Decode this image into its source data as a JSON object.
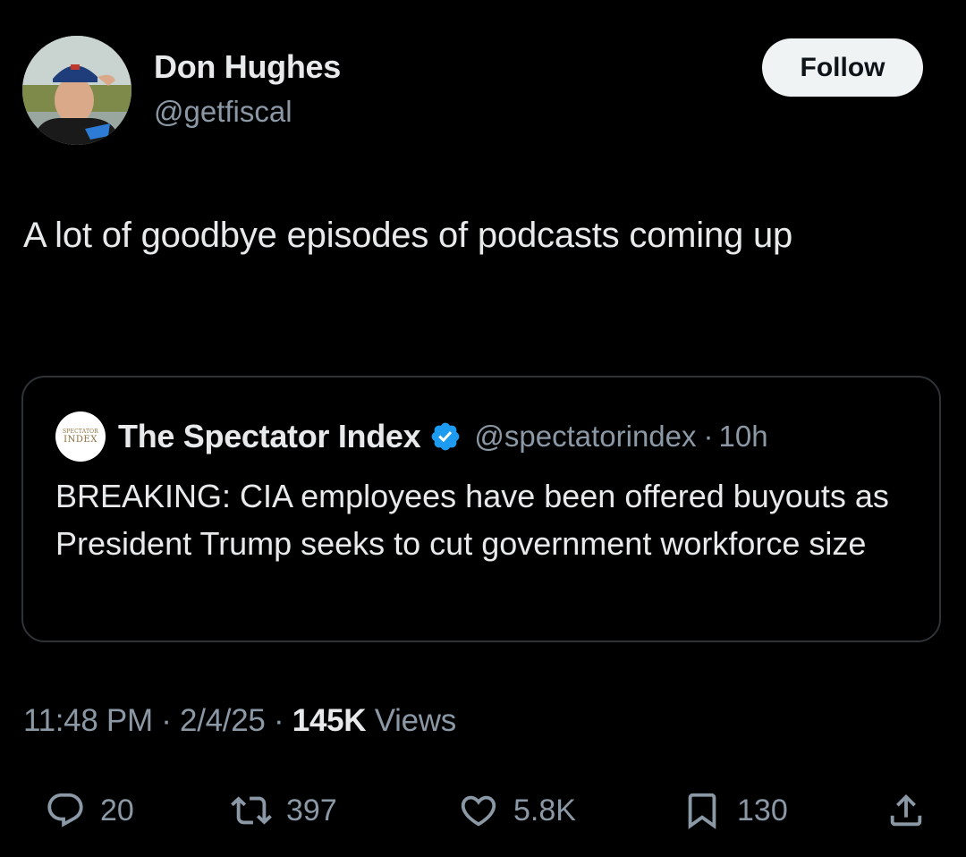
{
  "author": {
    "display_name": "Don Hughes",
    "handle": "@getfiscal",
    "follow_label": "Follow"
  },
  "tweet": {
    "text": "A lot of goodbye episodes of podcasts coming up"
  },
  "quoted_tweet": {
    "avatar_text_top": "SPECTATOR",
    "avatar_text_bottom": "INDEX",
    "display_name": "The Spectator Index",
    "verified": true,
    "handle": "@spectatorindex",
    "separator": "·",
    "time": "10h",
    "text": "BREAKING: CIA employees have been offered buyouts as President Trump seeks to cut government workforce size"
  },
  "meta": {
    "time": "11:48 PM",
    "date": "2/4/25",
    "separator": "·",
    "views_count": "145K",
    "views_label": "Views"
  },
  "actions": {
    "replies": "20",
    "reposts": "397",
    "likes": "5.8K",
    "bookmarks": "130"
  },
  "icons": {
    "reply": "reply-icon",
    "repost": "repost-icon",
    "like": "heart-icon",
    "bookmark": "bookmark-icon",
    "share": "share-icon",
    "verified": "verified-badge-icon"
  },
  "colors": {
    "background": "#000000",
    "text_primary": "#e7e9ea",
    "text_secondary": "#8b98a5",
    "border": "#2f3336",
    "verified_blue": "#1d9bf0",
    "follow_button_bg": "#eff3f4"
  }
}
